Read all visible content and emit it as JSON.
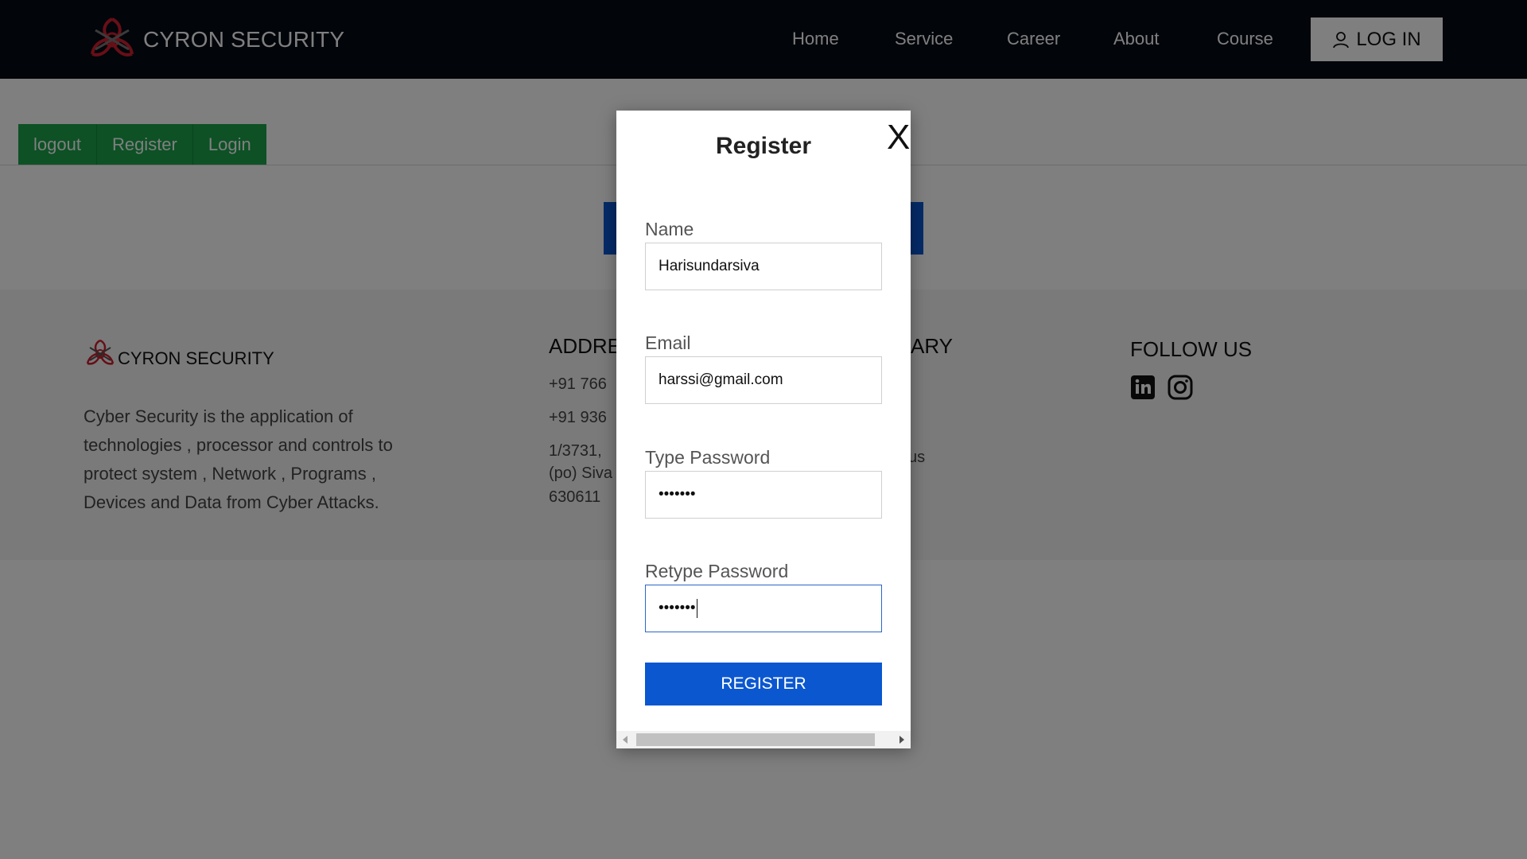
{
  "header": {
    "brand": "CYRON SECURITY",
    "nav": [
      "Home",
      "Service",
      "Career",
      "About",
      "Course"
    ],
    "login_label": "LOG IN"
  },
  "tabs": [
    "logout",
    "Register",
    "Login"
  ],
  "footer": {
    "brand": "CYRON SECURITY",
    "description": "Cyber Security is the application of technologies , processor and controls to protect system , Network , Programs , Devices and Data from Cyber Attacks.",
    "address_title": "ADDRE",
    "phone1": "+91 766",
    "phone2": "+91 936",
    "address_line1": "1/3731,",
    "address_line2": "(po) Siva",
    "address_line3": "630611",
    "col3_title": "ARY",
    "col3_item": "us",
    "follow_title": "FOLLOW US"
  },
  "modal": {
    "title": "Register",
    "close_label": "X",
    "name_label": "Name",
    "name_value": "Harisundarsiva",
    "email_label": "Email",
    "email_value": "harssi@gmail.com",
    "password_label": "Type Password",
    "password_value": "•••••••",
    "retype_label": "Retype Password",
    "retype_value": "•••••••",
    "submit_label": "REGISTER"
  },
  "colors": {
    "navbar": "#050a14",
    "tab_green": "#1aa34a",
    "primary_blue": "#0b57d0",
    "focus_blue": "#2b66c8"
  },
  "icons": [
    "biohazard-logo-icon",
    "user-icon",
    "linkedin-icon",
    "instagram-icon"
  ]
}
